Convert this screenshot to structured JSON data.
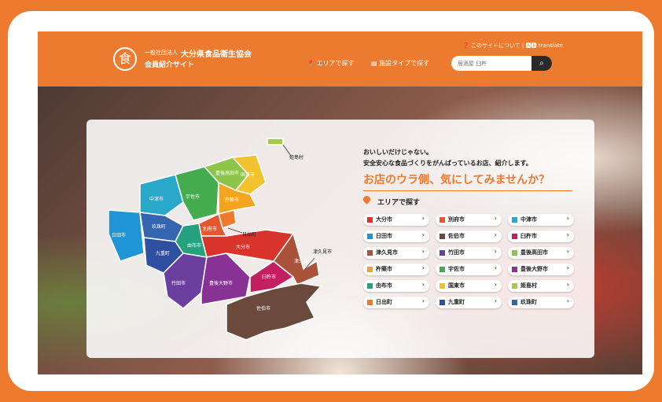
{
  "header": {
    "org_prefix": "一般社団法人",
    "org_name": "大分県食品衛生協会",
    "org_sub": "会員紹介サイト",
    "logo_glyph": "食",
    "about_link": "❓ このサイトについて",
    "separator": "|",
    "translate_link": "🅰🅱 translate",
    "nav_area": "エリアで探す",
    "nav_type": "施設タイプで探す",
    "search_placeholder": "居酒屋 臼杵"
  },
  "main": {
    "tagline_1": "おいしいだけじゃない。",
    "tagline_2": "安全安心な食品づくりをがんばっているお店、紹介します。",
    "headline": "お店のウラ側、気にしてみませんか？",
    "section_title": "エリアで探す",
    "accent_color": "#ee7a2e"
  },
  "map": {
    "regions": [
      {
        "label": "中津市",
        "color": "#2aa8c9"
      },
      {
        "label": "宇佐市",
        "color": "#44ab4e"
      },
      {
        "label": "豊後高田市",
        "color": "#8cc54a"
      },
      {
        "label": "国東市",
        "color": "#f2c230"
      },
      {
        "label": "姫島村",
        "color": "#a7c84b"
      },
      {
        "label": "杵築市",
        "color": "#f2a51d"
      },
      {
        "label": "日出町",
        "color": "#ee7a2e"
      },
      {
        "label": "別府市",
        "color": "#e5572e"
      },
      {
        "label": "日田市",
        "color": "#1f95d5"
      },
      {
        "label": "玖珠町",
        "color": "#3565ae"
      },
      {
        "label": "九重町",
        "color": "#2f4fa0"
      },
      {
        "label": "由布市",
        "color": "#27a07e"
      },
      {
        "label": "大分市",
        "color": "#d9342b"
      },
      {
        "label": "竹田市",
        "color": "#6b3fa0"
      },
      {
        "label": "豊後大野市",
        "color": "#883296"
      },
      {
        "label": "臼杵市",
        "color": "#c22060"
      },
      {
        "label": "津久見市",
        "color": "#a8533a"
      },
      {
        "label": "佐伯市",
        "color": "#6b4a3d"
      }
    ]
  },
  "areas": [
    {
      "label": "大分市",
      "color": "#d9342b"
    },
    {
      "label": "別府市",
      "color": "#e5572e"
    },
    {
      "label": "中津市",
      "color": "#2aa8c9"
    },
    {
      "label": "日田市",
      "color": "#1f95d5"
    },
    {
      "label": "佐伯市",
      "color": "#6b4a3d"
    },
    {
      "label": "臼杵市",
      "color": "#c22060"
    },
    {
      "label": "津久見市",
      "color": "#a8533a"
    },
    {
      "label": "竹田市",
      "color": "#6b3fa0"
    },
    {
      "label": "豊後高田市",
      "color": "#8cc54a"
    },
    {
      "label": "杵築市",
      "color": "#f2a51d"
    },
    {
      "label": "宇佐市",
      "color": "#44ab4e"
    },
    {
      "label": "豊後大野市",
      "color": "#883296"
    },
    {
      "label": "由布市",
      "color": "#27a07e"
    },
    {
      "label": "国東市",
      "color": "#f2c230"
    },
    {
      "label": "姫島村",
      "color": "#a7c84b"
    },
    {
      "label": "日出町",
      "color": "#ee7a2e"
    },
    {
      "label": "九重町",
      "color": "#2f4fa0"
    },
    {
      "label": "玖珠町",
      "color": "#3565ae"
    }
  ],
  "chevron": "›"
}
